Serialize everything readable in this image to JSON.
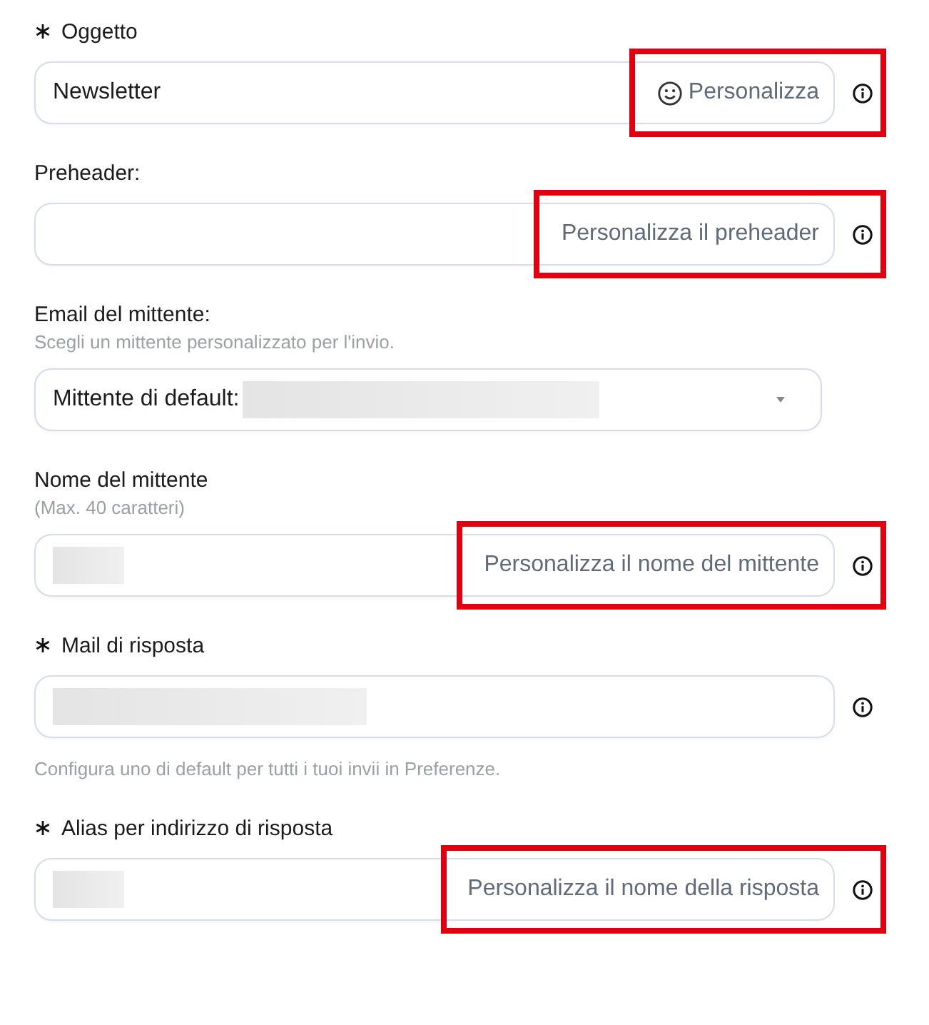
{
  "fields": [
    {
      "kind": "text",
      "label": "Oggetto",
      "required": true,
      "value": "Newsletter",
      "personalize": {
        "label": "Personalizza",
        "emoji_icon": true
      },
      "highlighted": true
    },
    {
      "kind": "text",
      "label": "Preheader:",
      "personalize": {
        "label": "Personalizza il preheader"
      },
      "highlighted": true
    },
    {
      "kind": "select",
      "label": "Email del mittente:",
      "hint": "Scegli un mittente personalizzato per l'invio.",
      "value": "Mittente di default:",
      "redacted": true
    },
    {
      "kind": "text",
      "label": "Nome del mittente",
      "hint": "(Max. 40 caratteri)",
      "redacted": true,
      "personalize": {
        "label": "Personalizza il nome del mittente"
      },
      "highlighted": true
    },
    {
      "kind": "text",
      "label": "Mail di risposta",
      "required": true,
      "redacted": true,
      "note": "Configura uno di default per tutti i tuoi invii in Preferenze."
    },
    {
      "kind": "text",
      "label": "Alias per indirizzo di risposta",
      "required": true,
      "redacted": true,
      "personalize": {
        "label": "Personalizza il nome della risposta"
      },
      "highlighted": true
    }
  ]
}
